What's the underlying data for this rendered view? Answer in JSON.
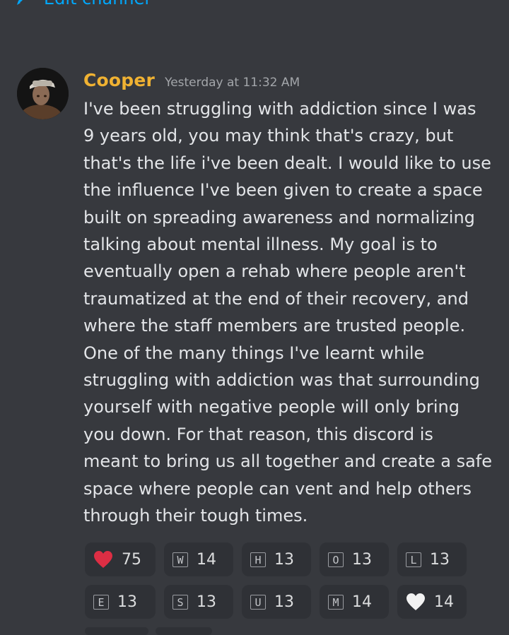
{
  "top": {
    "link_label": "Edit channel",
    "link_icon": "pencil-icon"
  },
  "message": {
    "author": "Cooper",
    "timestamp": "Yesterday at 11:32 AM",
    "text": "I've been struggling with addiction since I was\n9 years old, you may think that's crazy, but\nthat's the life i've been dealt. I would like to use\nthe influence I've been given to create a space\nbuilt on spreading awareness and normalizing\ntalking about mental illness. My goal is to\neventually open a rehab where people aren't\ntraumatized at the end of their recovery, and\nwhere the staff members are trusted people.\nOne of the many things I've learnt while\nstruggling with addiction was that surrounding\nyourself with negative people will only bring\nyou down. For that reason, this discord is\nmeant to bring us all together and create a safe\nspace where people can vent and help others\nthrough their tough times.",
    "author_color": "#f0b232"
  },
  "reactions": [
    {
      "emoji": "red-heart",
      "count": "75"
    },
    {
      "letter": "W",
      "count": "14"
    },
    {
      "letter": "H",
      "count": "13"
    },
    {
      "letter": "O",
      "count": "13"
    },
    {
      "letter": "L",
      "count": "13"
    },
    {
      "letter": "E",
      "count": "13"
    },
    {
      "letter": "S",
      "count": "13"
    },
    {
      "letter": "U",
      "count": "13"
    },
    {
      "letter": "M",
      "count": "14"
    },
    {
      "emoji": "white-heart",
      "count": "14"
    }
  ],
  "colors": {
    "background": "#37393e",
    "reaction_bg": "#2f3136",
    "link": "#00a8fc",
    "red_heart": "#dd2e44",
    "white_heart": "#ffffff"
  }
}
